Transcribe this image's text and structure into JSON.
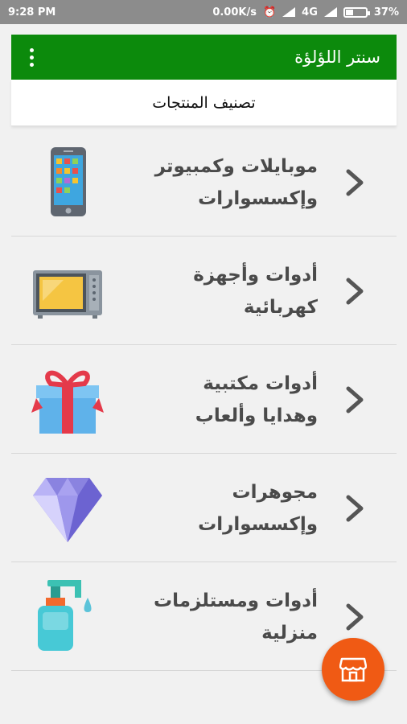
{
  "status_bar": {
    "time": "9:28 PM",
    "speed": "0.00K/s",
    "network": "4G",
    "battery": "37%",
    "battery_level": 0.37
  },
  "app_bar": {
    "title": "سنتر اللؤلؤة"
  },
  "section_header": {
    "title": "تصنيف المنتجات"
  },
  "categories": [
    {
      "line1": "موبايلات وكمبيوتر",
      "line2": "وإكسسوارات",
      "icon": "smartphone-icon"
    },
    {
      "line1": "أدوات وأجهزة",
      "line2": "كهربائية",
      "icon": "microwave-icon"
    },
    {
      "line1": "أدوات مكتبية",
      "line2": "وهدايا وألعاب",
      "icon": "gift-icon"
    },
    {
      "line1": "مجوهرات",
      "line2": "وإكسسوارات",
      "icon": "diamond-icon"
    },
    {
      "line1": "أدوات ومستلزمات",
      "line2": "منزلية",
      "icon": "soap-dispenser-icon"
    }
  ],
  "colors": {
    "app_bar": "#0c8a0c",
    "fab": "#f05a14"
  }
}
